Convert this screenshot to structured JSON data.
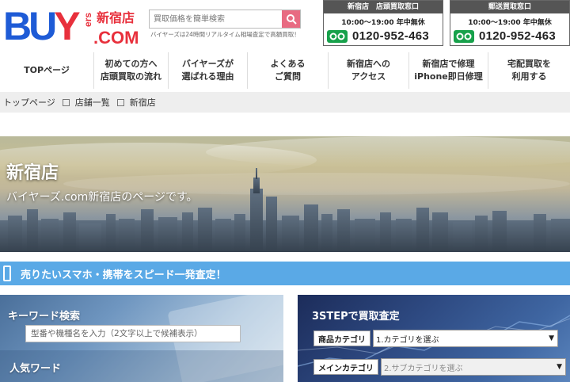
{
  "brand": {
    "logo_main": "BUY",
    "logo_side": "ers",
    "store": "新宿店",
    "domain": ".COM",
    "colors": {
      "blue": "#1e5bd6",
      "red": "#e8303c"
    }
  },
  "search": {
    "placeholder": "買取価格を簡単検索",
    "note": "バイヤーズは24時間リアルタイム相場査定で高額買取！",
    "icon": "search-icon"
  },
  "contacts": [
    {
      "title": "新宿店　店頭買取窓口",
      "hours": "10:00～19:00 年中無休",
      "phone": "0120-952-463"
    },
    {
      "title": "郵送買取窓口",
      "hours": "10:00～19:00 年中無休",
      "phone": "0120-952-463"
    }
  ],
  "nav": [
    {
      "line1": "TOPページ",
      "line2": ""
    },
    {
      "line1": "初めての方へ",
      "line2": "店頭買取の流れ"
    },
    {
      "line1": "バイヤーズが",
      "line2": "選ばれる理由"
    },
    {
      "line1": "よくある",
      "line2": "ご質問"
    },
    {
      "line1": "新宿店への",
      "line2": "アクセス"
    },
    {
      "line1": "新宿店で修理",
      "line2": "iPhone即日修理"
    },
    {
      "line1": "宅配買取を",
      "line2": "利用する"
    }
  ],
  "breadcrumb": [
    "トップページ",
    "店舗一覧",
    "新宿店"
  ],
  "hero": {
    "title": "新宿店",
    "subtitle": "バイヤーズ.com新宿店のページです。"
  },
  "banner": {
    "text": "売りたいスマホ・携帯をスピード一発査定！",
    "color": "#5aa9e6"
  },
  "keyword": {
    "title": "キーワード検索",
    "placeholder": "型番や機種名を入力（2文字以上で候補表示）",
    "popular_title": "人気ワード"
  },
  "steps": {
    "title": "3STEPで買取査定",
    "rows": [
      {
        "label": "商品カテゴリ",
        "value": "1.カテゴリを選ぶ",
        "disabled": false
      },
      {
        "label": "メインカテゴリ",
        "value": "2.サブカテゴリを選ぶ",
        "disabled": true
      }
    ]
  }
}
